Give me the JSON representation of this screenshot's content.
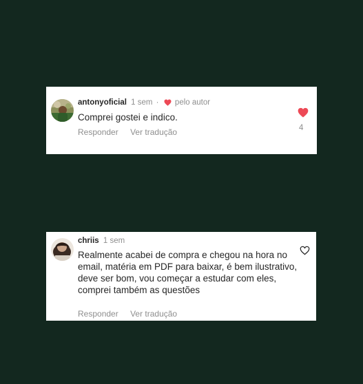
{
  "colors": {
    "background": "#13281f",
    "card": "#ffffff",
    "liked_heart": "#ed4956",
    "username": "#262626",
    "secondary": "#8e8e8e"
  },
  "comments": [
    {
      "username": "antonyoficial",
      "time": "1 sem",
      "separator": "·",
      "author_badge": "pelo autor",
      "author_badge_icon": "heart-icon",
      "text": "Comprei gostei e indico.",
      "reply_label": "Responder",
      "translate_label": "Ver tradução",
      "like_icon": "heart-filled-icon",
      "liked": true,
      "like_count": "4"
    },
    {
      "username": "chriis",
      "time": "1 sem",
      "text": "Realmente acabei de compra e chegou na hora no email, matéria em PDF para baixar, é bem ilustrativo, deve ser bom, vou começar a estudar com eles, comprei também as questões",
      "reply_label": "Responder",
      "translate_label": "Ver tradução",
      "like_icon": "heart-outline-icon",
      "liked": false
    }
  ]
}
